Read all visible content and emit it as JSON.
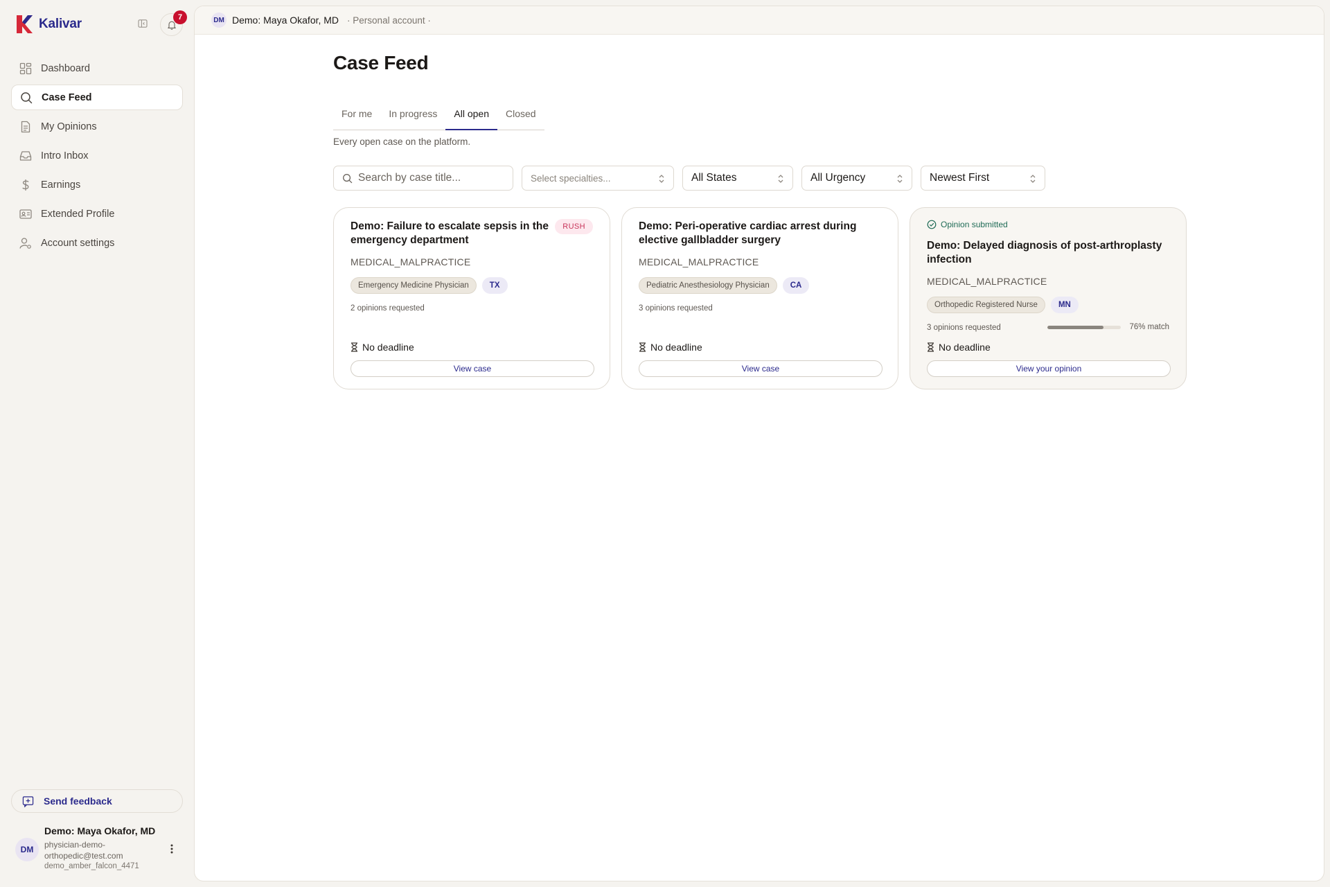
{
  "brand": {
    "name": "Kalivar"
  },
  "notifications": {
    "count": "7"
  },
  "nav": {
    "items": [
      {
        "label": "Dashboard",
        "icon": "grid-icon"
      },
      {
        "label": "Case Feed",
        "icon": "search-icon"
      },
      {
        "label": "My Opinions",
        "icon": "document-icon"
      },
      {
        "label": "Intro Inbox",
        "icon": "inbox-icon"
      },
      {
        "label": "Earnings",
        "icon": "dollar-icon"
      },
      {
        "label": "Extended Profile",
        "icon": "id-card-icon"
      },
      {
        "label": "Account settings",
        "icon": "user-gear-icon"
      }
    ]
  },
  "feedback": {
    "label": "Send feedback"
  },
  "user": {
    "initials": "DM",
    "name": "Demo: Maya Okafor, MD",
    "email": "physician-demo-orthopedic@test.com",
    "handle": "demo_amber_falcon_4471"
  },
  "topbar": {
    "initials": "DM",
    "name": "Demo: Maya Okafor, MD",
    "account_type": "· Personal account ·"
  },
  "page": {
    "title": "Case Feed",
    "tabs": [
      {
        "label": "For me"
      },
      {
        "label": "In progress"
      },
      {
        "label": "All open"
      },
      {
        "label": "Closed"
      }
    ],
    "active_tab": "All open",
    "description": "Every open case on the platform."
  },
  "filters": {
    "search_placeholder": "Search by case title...",
    "specialties": "Select specialties...",
    "states": "All States",
    "urgency": "All Urgency",
    "sort": "Newest First"
  },
  "cards": [
    {
      "title": "Demo: Failure to escalate sepsis in the emergency department",
      "badge": "RUSH",
      "case_type": "MEDICAL_MALPRACTICE",
      "specialty": "Emergency Medicine Physician",
      "state": "TX",
      "opinions": "2 opinions requested",
      "deadline": "No deadline",
      "action": "View case"
    },
    {
      "title": "Demo: Peri-operative cardiac arrest during elective gallbladder surgery",
      "case_type": "MEDICAL_MALPRACTICE",
      "specialty": "Pediatric Anesthesiology Physician",
      "state": "CA",
      "opinions": "3 opinions requested",
      "deadline": "No deadline",
      "action": "View case"
    },
    {
      "status": "Opinion submitted",
      "title": "Demo: Delayed diagnosis of post-arthroplasty infection",
      "case_type": "MEDICAL_MALPRACTICE",
      "specialty": "Orthopedic Registered Nurse",
      "state": "MN",
      "opinions": "3 opinions requested",
      "match_percent": 76,
      "match_label": "76% match",
      "deadline": "No deadline",
      "action": "View your opinion"
    }
  ],
  "colors": {
    "brand": "#2b2a8c",
    "logo_red": "#d62839",
    "badge_red": "#c8102e",
    "success": "#1f6b56"
  }
}
